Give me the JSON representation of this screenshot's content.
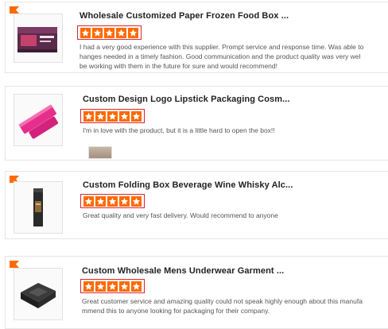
{
  "colors": {
    "star": "#ff6a00",
    "highlight_border": "#d8262a",
    "ribbon": "#ff6a00"
  },
  "reviews": [
    {
      "product_title": "Wholesale Customized Paper Frozen Food Box ...",
      "rating": 5,
      "text_lines": [
        "I had a very good experience with this supplier. Prompt service and response time. Was able to",
        "hanges needed in a timely fashion. Good communication and the product quality was very wel",
        "be working with them in the future for sure and would recommend!"
      ],
      "thumb_icon": "food-box-icon"
    },
    {
      "product_title": "Custom Design Logo Lipstick Packaging Cosm...",
      "rating": 5,
      "text_lines": [
        "I'm in love with the product, but it is a little hard to open the box!!"
      ],
      "thumb_icon": "lipstick-box-icon"
    },
    {
      "product_title": "Custom Folding Box Beverage Wine Whisky Alc...",
      "rating": 5,
      "text_lines": [
        "Great quality and very fast delivery. Would recommend to anyone"
      ],
      "thumb_icon": "wine-box-icon"
    },
    {
      "product_title": "Custom Wholesale Mens Underwear Garment ...",
      "rating": 5,
      "text_lines": [
        "Great customer service and amazing quality could not speak highly enough about this manufa",
        "mmend this to anyone looking for packaging for their company."
      ],
      "thumb_icon": "gift-box-icon"
    }
  ]
}
